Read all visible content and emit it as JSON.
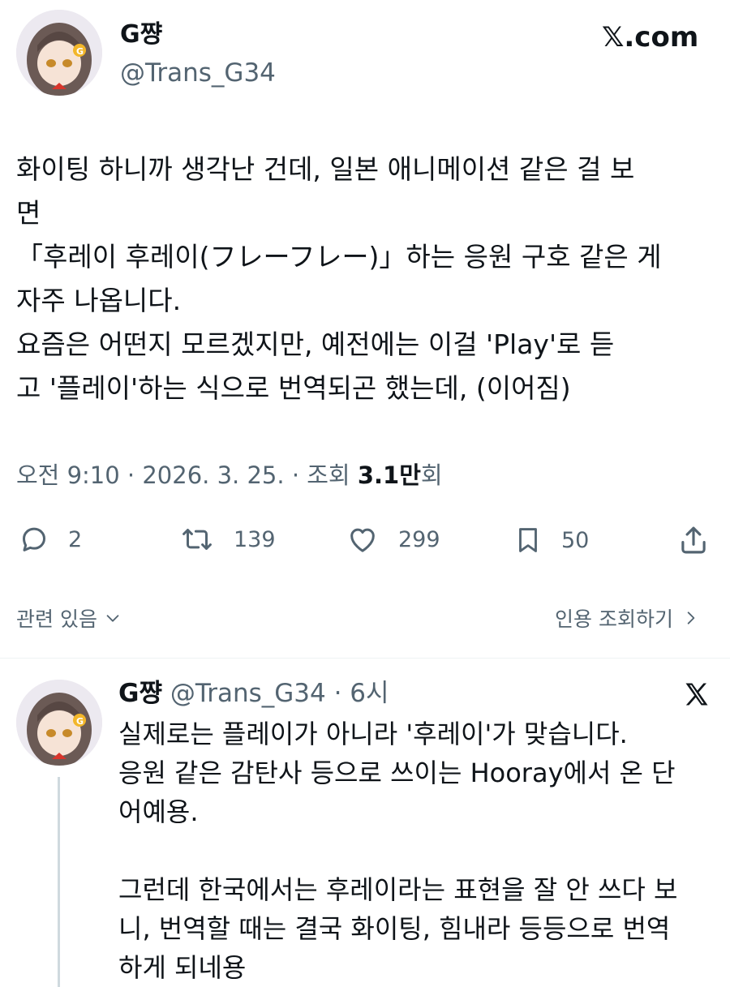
{
  "post": {
    "author_name": "G쨩",
    "author_handle": "@Trans_G34",
    "brand": "𝕏.com",
    "text": "화이팅 하니까 생각난 건데, 일본 애니메이션 같은 걸 보\n면\n「후레이 후레이(フレーフレー)」하는 응원 구호 같은 게\n자주 나옵니다.\n요즘은 어떤지 모르겠지만, 예전에는 이걸 'Play'로 듣\n고 '플레이'하는 식으로 번역되곤 했는데, (이어짐)",
    "time_prefix": "오전 9:10 · 2026. 3. 25. · 조회 ",
    "views_number": "3.1만",
    "views_suffix": "회"
  },
  "actions": {
    "reply_count": "2",
    "retweet_count": "139",
    "like_count": "299",
    "bookmark_count": "50"
  },
  "footer": {
    "related_label": "관련 있음",
    "quotes_label": "인용 조회하기"
  },
  "reply": {
    "author_name": "G쨩",
    "author_handle": "@Trans_G34",
    "time": "· 6시",
    "text": "실제로는 플레이가 아니라 '후레이'가 맞습니다.\n응원 같은 감탄사 등으로 쓰이는 Hooray에서 온 단\n어예용.\n\n그런데 한국에서는 후레이라는 표현을 잘 안 쓰다 보\n니, 번역할 때는 결국 화이팅, 힘내라 등등으로 번역\n하게 되네용"
  },
  "colors": {
    "text": "#0f1419",
    "secondary": "#536471",
    "divider": "#eff3f4",
    "thread": "#cfd9de"
  }
}
